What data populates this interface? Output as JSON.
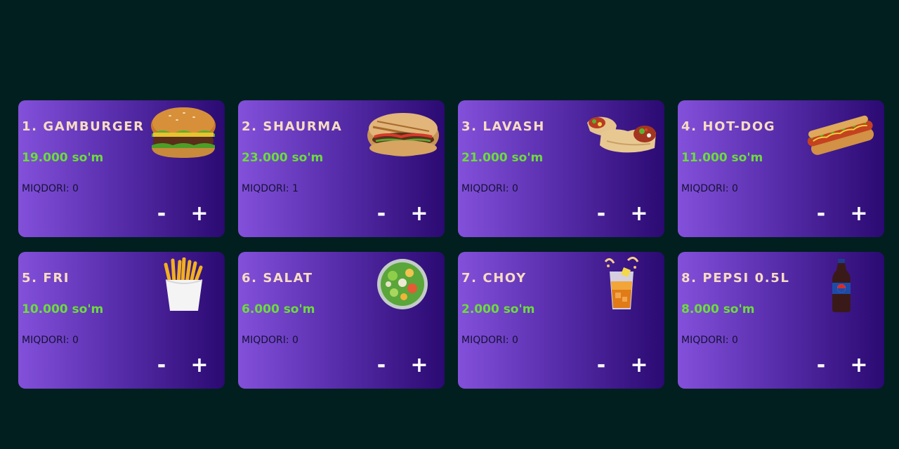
{
  "products": [
    {
      "title": "1. GAMBURGER",
      "price": "19.000 so'm",
      "quantity": "MIQDORI: 0",
      "icon": "burger-icon"
    },
    {
      "title": "2. SHAURMA",
      "price": "23.000 so'm",
      "quantity": "MIQDORI: 1",
      "icon": "shaurma-icon"
    },
    {
      "title": "3. LAVASH",
      "price": "21.000 so'm",
      "quantity": "MIQDORI: 0",
      "icon": "lavash-icon"
    },
    {
      "title": "4. HOT-DOG",
      "price": "11.000 so'm",
      "quantity": "MIQDORI: 0",
      "icon": "hotdog-icon"
    },
    {
      "title": "5. FRI",
      "price": "10.000 so'm",
      "quantity": "MIQDORI: 0",
      "icon": "fries-icon"
    },
    {
      "title": "6. SALAT",
      "price": "6.000 so'm",
      "quantity": "MIQDORI: 0",
      "icon": "salad-icon"
    },
    {
      "title": "7. CHOY",
      "price": "2.000 so'm",
      "quantity": "MIQDORI: 0",
      "icon": "tea-icon"
    },
    {
      "title": "8. PEPSI 0.5L",
      "price": "8.000 so'm",
      "quantity": "MIQDORI: 0",
      "icon": "pepsi-bottle-icon"
    }
  ],
  "buttons": {
    "minus_label": "-",
    "plus_label": "+"
  },
  "colors": {
    "background": "#011f1f",
    "card_gradient_start": "#8350da",
    "card_gradient_end": "#2b0a72",
    "title": "#f7dcc2",
    "price": "#6bdd3b",
    "quantity": "#141235"
  }
}
